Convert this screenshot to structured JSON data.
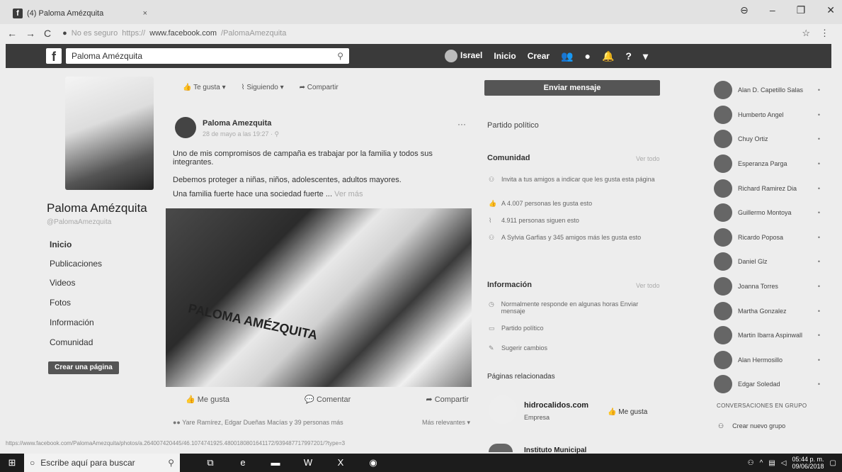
{
  "browser": {
    "tab_title": "(4) Paloma Amézquita",
    "tab_close": "×",
    "minimize": "–",
    "maximize": "❐",
    "close": "✕",
    "security": "No es seguro",
    "url_prefix": "https://",
    "url_domain": "www.facebook.com",
    "url_path": "/PalomaAmezquita",
    "status_url": "https://www.facebook.com/PalomaAmezquita/photos/a.264007420445/46.1074741925.4800180801641172/939487717997201/?type=3"
  },
  "fb": {
    "search_value": "Paloma Amézquita",
    "nav_user": "Israel",
    "nav_home": "Inicio",
    "nav_create": "Crear"
  },
  "profile": {
    "name": "Paloma Amézquita",
    "handle": "@PalomaAmezquita",
    "nav": [
      "Inicio",
      "Publicaciones",
      "Videos",
      "Fotos",
      "Información",
      "Comunidad"
    ],
    "create_page": "Crear una página"
  },
  "page_actions": {
    "like": "Te gusta ▾",
    "following": "Siguiendo ▾",
    "share": "Compartir"
  },
  "post": {
    "author": "Paloma Amezquita",
    "time": "28 de mayo a las 19:27 · ⚲",
    "line1": "Uno de mis compromisos de campaña es trabajar por la familia y todos sus integrantes.",
    "line2": "Debemos proteger a niñas, niños, adolescentes, adultos mayores.",
    "line3": "Una familia fuerte hace una sociedad fuerte ...",
    "see_more": "Ver más",
    "photo_label": "PALOMA AMÉZQUITA",
    "like": "Me gusta",
    "comment": "Comentar",
    "share": "Compartir",
    "reactions": "Yare Ramírez, Edgar Dueñas Macías y 39 personas más",
    "relevant": "Más relevantes ▾"
  },
  "sidebar": {
    "send_message": "Enviar mensaje",
    "category": "Partido político",
    "community_title": "Comunidad",
    "see_all": "Ver todo",
    "community_items": [
      "Invita a tus amigos a indicar que les gusta esta página",
      "A 4.007 personas les gusta esto",
      "4.911 personas siguen esto",
      "A Sylvia Garfias y 345 amigos más les gusta esto"
    ],
    "info_title": "Información",
    "info_items": [
      "Normalmente responde en algunas horas Enviar mensaje",
      "Partido político",
      "Sugerir cambios"
    ],
    "related_title": "Páginas relacionadas",
    "related_name": "hidrocalidos.com",
    "related_type": "Empresa",
    "related_like": "Me gusta",
    "related2": "Instituto Municipal"
  },
  "contacts": [
    "Alan D. Capetillo Salas",
    "Humberto Angel",
    "Chuy Ortiz",
    "Esperanza Parga",
    "Richard Ramirez Dia",
    "Guillermo Montoya",
    "Ricardo Poposa",
    "Daniel Glz",
    "Joanna Torres",
    "Martha Gonzalez",
    "Martin Ibarra Aspinwall",
    "Alan Hermosillo",
    "Edgar Soledad"
  ],
  "group_conv": "CONVERSACIONES EN GRUPO",
  "new_group": "Crear nuevo grupo",
  "taskbar": {
    "search": "Escribe aquí para buscar",
    "time": "05:44 p. m.",
    "date": "09/06/2018"
  }
}
